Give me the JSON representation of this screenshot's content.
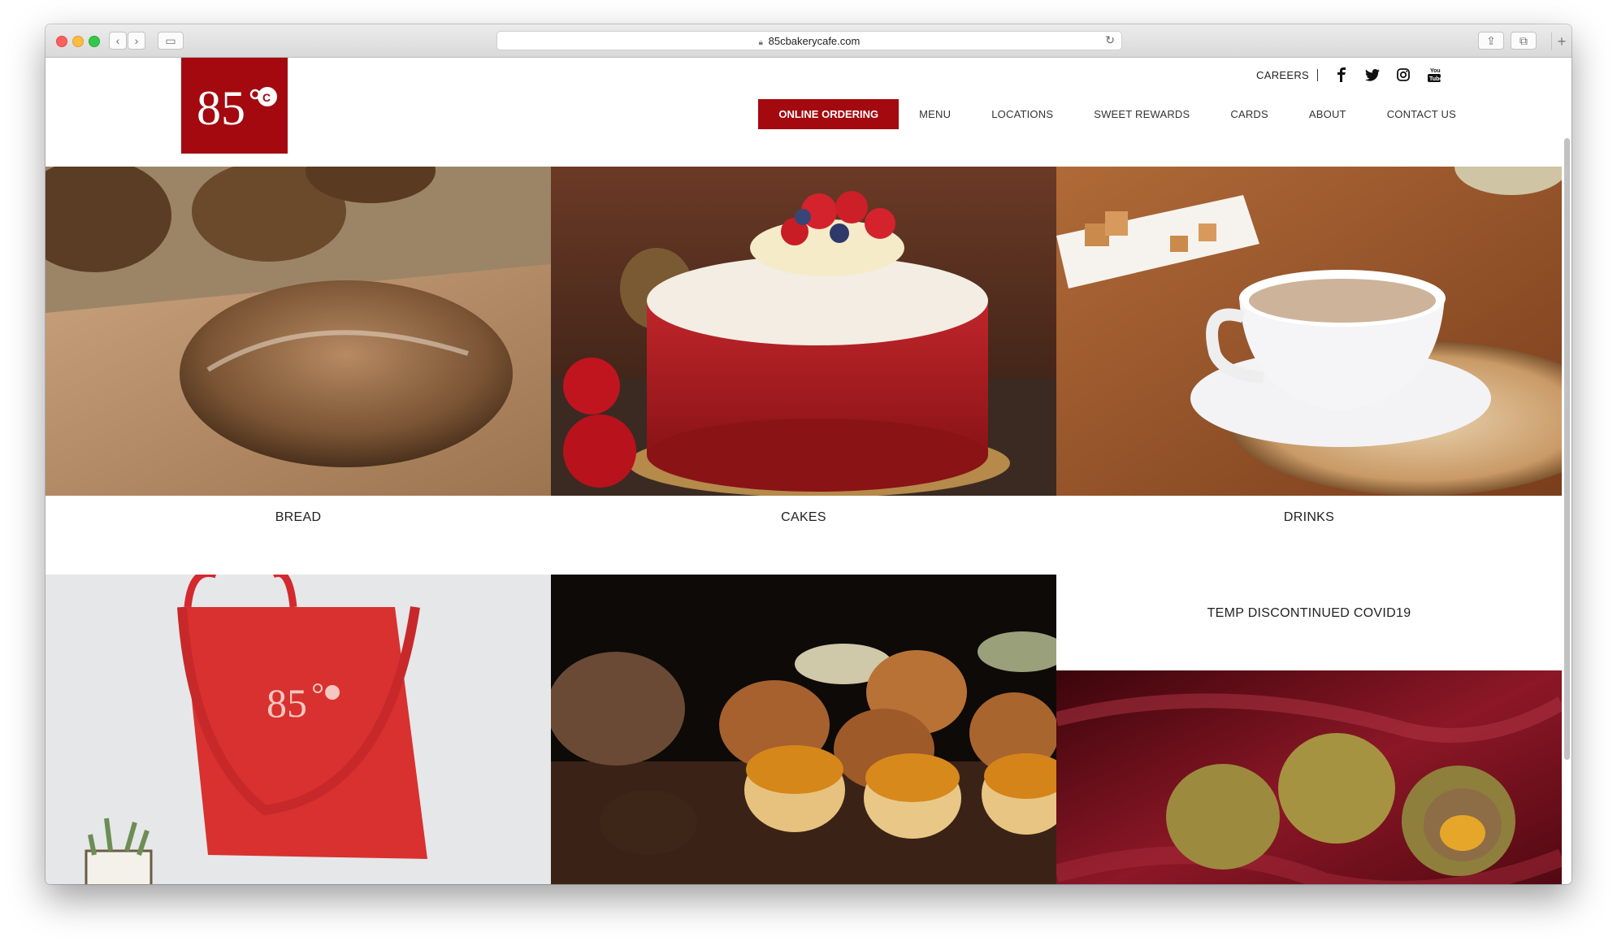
{
  "browser": {
    "url": "85cbakerycafe.com"
  },
  "header": {
    "logo_text": "85",
    "careers": "CAREERS",
    "social": [
      "facebook-icon",
      "twitter-icon",
      "instagram-icon",
      "youtube-icon"
    ],
    "nav": [
      "ONLINE ORDERING",
      "MENU",
      "LOCATIONS",
      "SWEET REWARDS",
      "CARDS",
      "ABOUT",
      "CONTACT US"
    ]
  },
  "categories": [
    {
      "label": "BREAD"
    },
    {
      "label": "CAKES"
    },
    {
      "label": "DRINKS"
    },
    {
      "label": ""
    },
    {
      "label": ""
    },
    {
      "label": "TEMP DISCONTINUED COVID19"
    }
  ],
  "colors": {
    "brand_red": "#a3090f",
    "text": "#222222"
  }
}
